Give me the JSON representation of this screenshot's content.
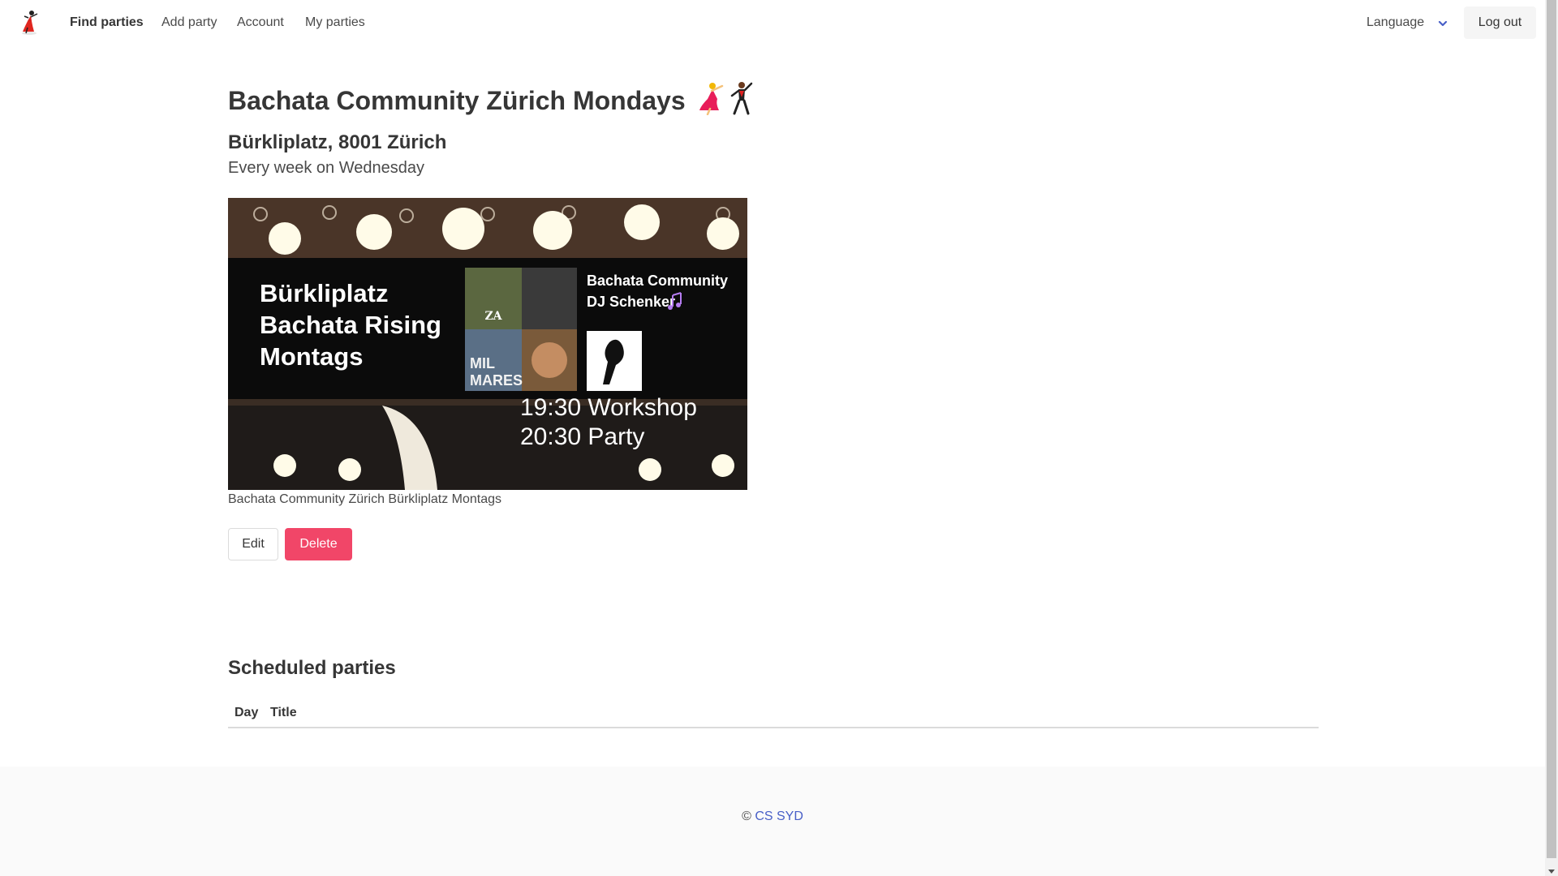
{
  "nav": {
    "items": [
      {
        "label": "Find parties",
        "active": true
      },
      {
        "label": "Add party",
        "active": false
      },
      {
        "label": "Account",
        "active": false
      },
      {
        "label": "My parties",
        "active": false
      }
    ],
    "language_label": "Language",
    "logout_label": "Log out"
  },
  "party": {
    "title": "Bachata Community Zürich Mondays",
    "address": "Bürkliplatz, 8001 Zürich",
    "recurrence": "Every week on Wednesday",
    "poster": {
      "heading_lines": [
        "Bürkliplatz",
        "Bachata Rising",
        "Montags"
      ],
      "dj_line1": "Bachata Community",
      "dj_line2": "DJ Schenker",
      "album_text_1": "ZA",
      "album_text_2": "MIL",
      "album_text_3": "MARES",
      "time_workshop": "19:30 Workshop",
      "time_party": "20:30 Party"
    },
    "caption": "Bachata Community Zürich Bürkliplatz Montags"
  },
  "actions": {
    "edit_label": "Edit",
    "delete_label": "Delete"
  },
  "scheduled": {
    "title": "Scheduled parties",
    "columns": [
      "Day",
      "Title"
    ],
    "rows": []
  },
  "footer": {
    "copyright_symbol": "©",
    "link_text": "CS SYD"
  },
  "colors": {
    "accent": "#485fc7",
    "danger": "#f14668",
    "text": "#4a4a4a",
    "heading": "#363636"
  }
}
